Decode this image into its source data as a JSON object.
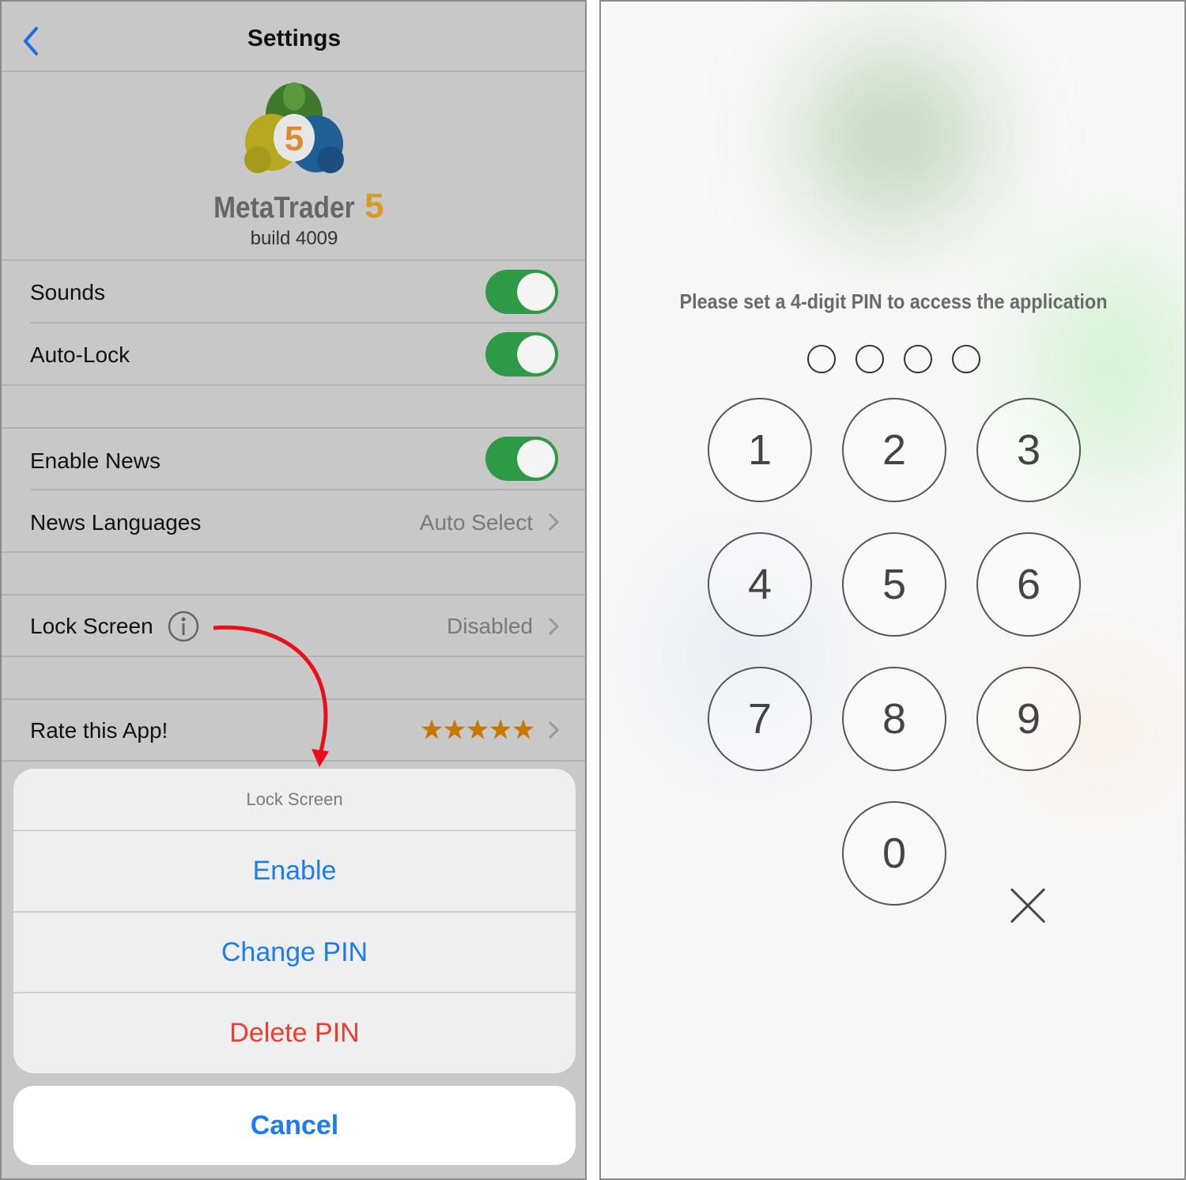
{
  "settings": {
    "title": "Settings",
    "app_name": "MetaTrader",
    "app_version_mark": "5",
    "build": "build 4009",
    "rows": [
      {
        "label": "Sounds",
        "type": "toggle",
        "on": true
      },
      {
        "label": "Auto-Lock",
        "type": "toggle",
        "on": true
      },
      {
        "label": "Enable News",
        "type": "toggle",
        "on": true
      },
      {
        "label": "News Languages",
        "type": "link",
        "value": "Auto Select"
      },
      {
        "label": "Lock Screen",
        "type": "link",
        "value": "Disabled"
      },
      {
        "label": "Rate this App!",
        "type": "rating",
        "rating": 5,
        "max": 5
      }
    ],
    "toggle_color": "#2e9a45",
    "star_color": "#c87800"
  },
  "action_sheet": {
    "title": "Lock Screen",
    "options": [
      {
        "label": "Enable",
        "color": "#1a7cf0"
      },
      {
        "label": "Change PIN",
        "color": "#1a7cf0"
      },
      {
        "label": "Delete PIN",
        "color": "#f03c2e"
      }
    ],
    "cancel": "Cancel"
  },
  "pin": {
    "prompt": "Please set a 4-digit PIN to access the application",
    "digits_entered": 0,
    "digits_total": 4,
    "keys": [
      "1",
      "2",
      "3",
      "4",
      "5",
      "6",
      "7",
      "8",
      "9",
      "0"
    ],
    "delete_icon": "close-icon"
  },
  "annotation": {
    "arrow_color": "#e8101a"
  }
}
